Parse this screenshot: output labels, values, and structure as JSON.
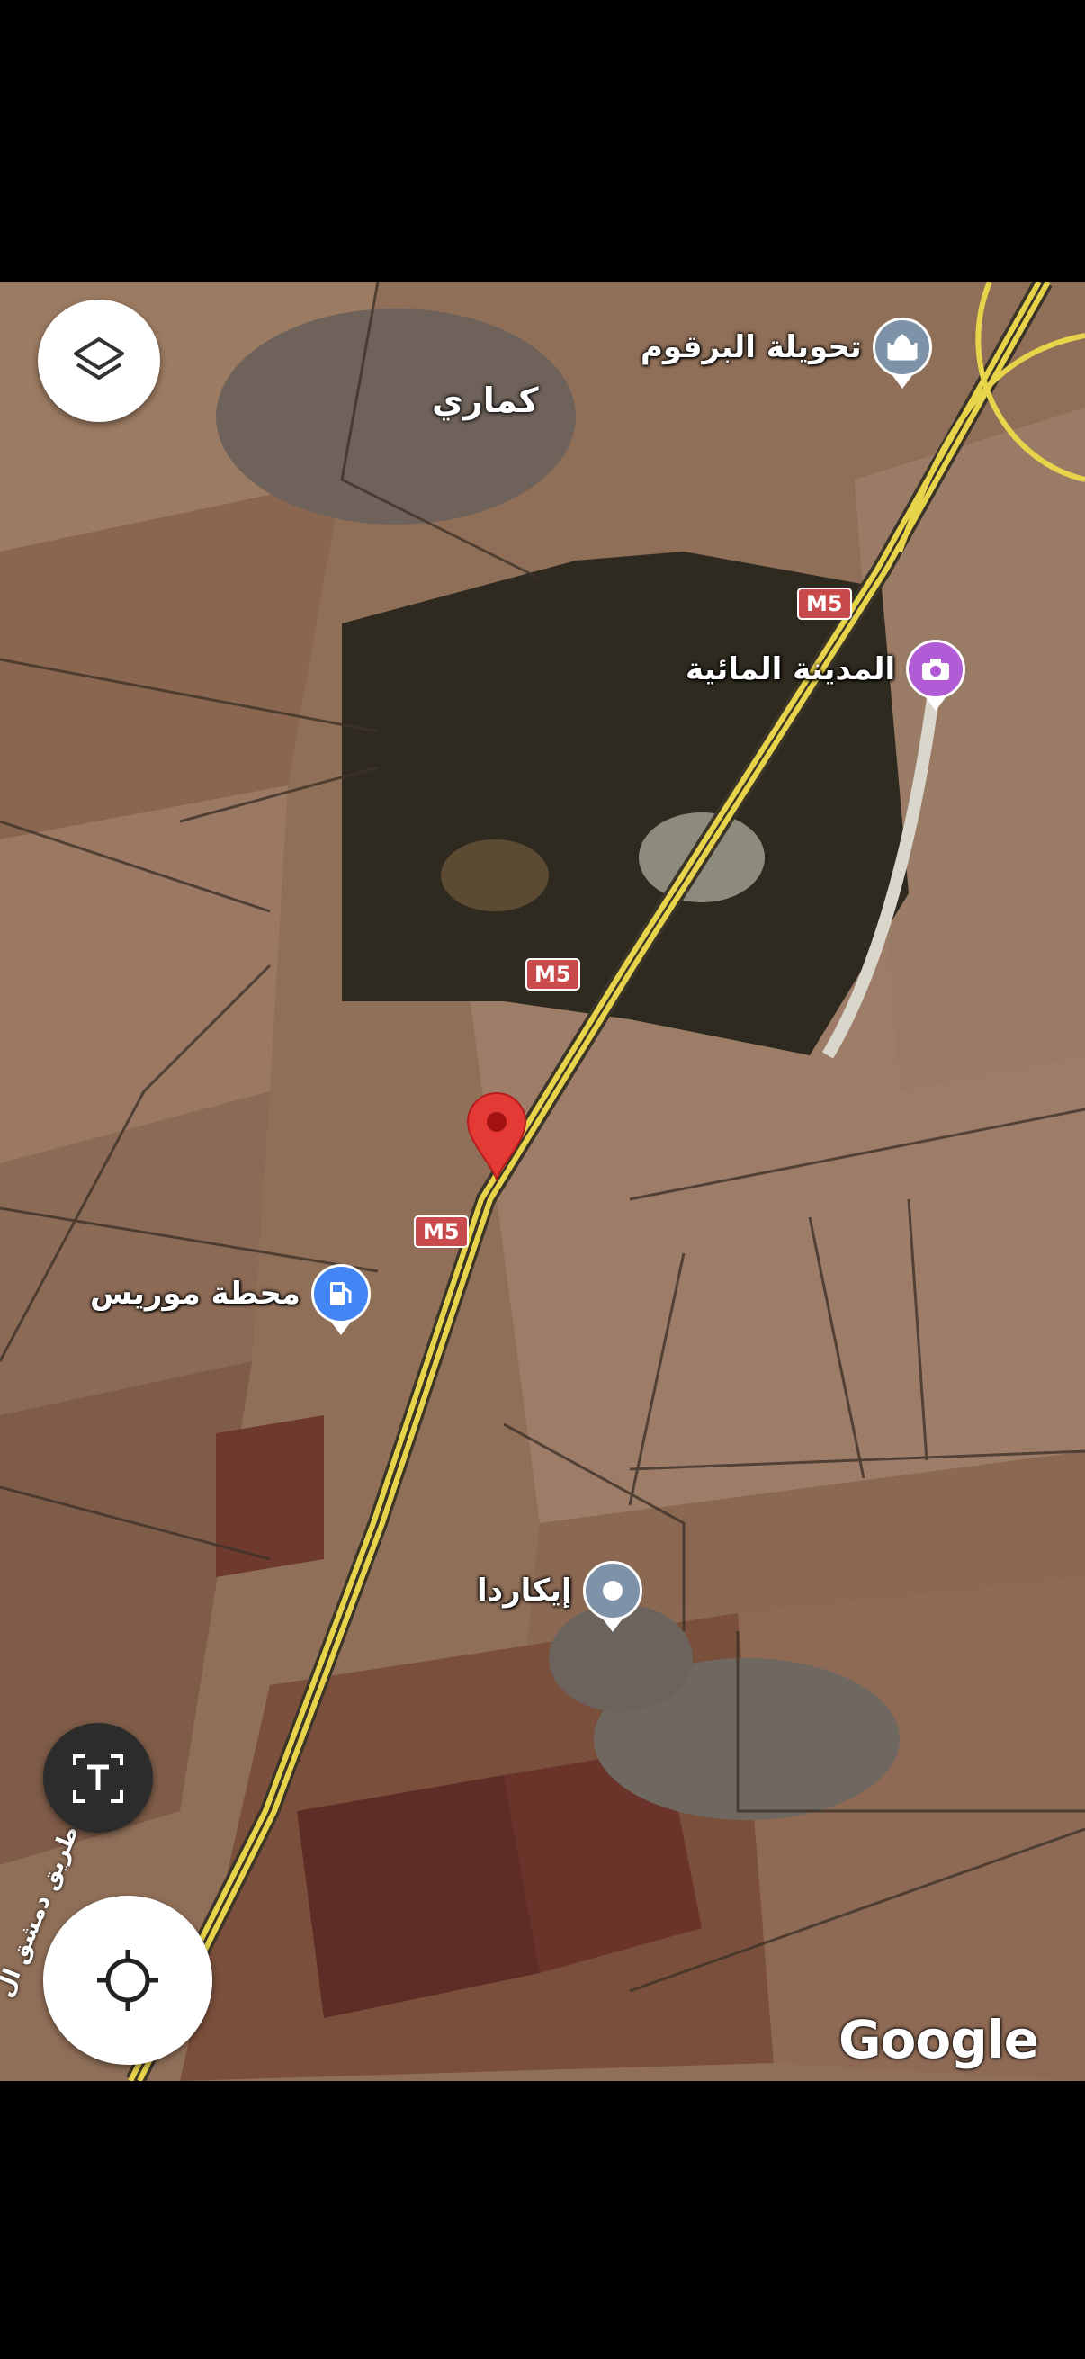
{
  "map": {
    "town_label": "كماري",
    "road_shields": [
      "M5",
      "M5",
      "M5"
    ],
    "side_road_label": "طريق دمشق ال",
    "attribution": "Google",
    "places": [
      {
        "name": "تحويلة البرقوم",
        "icon": "mosque-icon",
        "color": "#7f93a8"
      },
      {
        "name": "المدينة المائية",
        "icon": "camera-icon",
        "color": "#b15cd6"
      },
      {
        "name": "محطة موريس",
        "icon": "gas-station-icon",
        "color": "#4285f4"
      },
      {
        "name": "إيكاردا",
        "icon": "dot-marker-icon",
        "color": "#7f93a8"
      }
    ],
    "selected_pin": {
      "icon": "red-location-pin-icon",
      "color": "#e53935"
    }
  },
  "controls": {
    "layers_button": "layers-icon",
    "text_lens_button": "text-recognition-icon",
    "my_location_button": "my-location-icon"
  },
  "colors": {
    "highway": "#e8d44a",
    "field_light": "#9c7a5f",
    "field_dark": "#6b4a36",
    "forest": "#2f2a20"
  }
}
